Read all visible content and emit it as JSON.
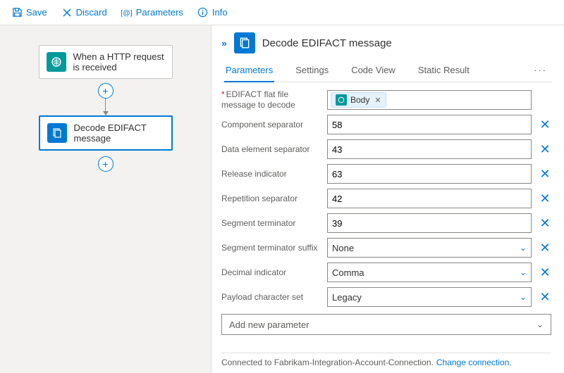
{
  "toolbar": {
    "save": "Save",
    "discard": "Discard",
    "parameters": "Parameters",
    "info": "Info"
  },
  "canvas": {
    "node_http": "When a HTTP request is received",
    "node_edifact": "Decode EDIFACT message"
  },
  "panel": {
    "title": "Decode EDIFACT message",
    "tabs": {
      "parameters": "Parameters",
      "settings": "Settings",
      "code_view": "Code View",
      "static_result": "Static Result"
    },
    "fields": {
      "flatfile_label": "EDIFACT flat file message to decode",
      "flatfile_chip": "Body",
      "component_sep_label": "Component separator",
      "component_sep_value": "58",
      "data_elem_sep_label": "Data element separator",
      "data_elem_sep_value": "43",
      "release_ind_label": "Release indicator",
      "release_ind_value": "63",
      "repetition_sep_label": "Repetition separator",
      "repetition_sep_value": "42",
      "segment_term_label": "Segment terminator",
      "segment_term_value": "39",
      "segment_term_suffix_label": "Segment terminator suffix",
      "segment_term_suffix_value": "None",
      "decimal_ind_label": "Decimal indicator",
      "decimal_ind_value": "Comma",
      "payload_charset_label": "Payload character set",
      "payload_charset_value": "Legacy"
    },
    "add_param": "Add new parameter",
    "footer_text": "Connected to Fabrikam-Integration-Account-Connection.",
    "footer_link": "Change connection."
  }
}
